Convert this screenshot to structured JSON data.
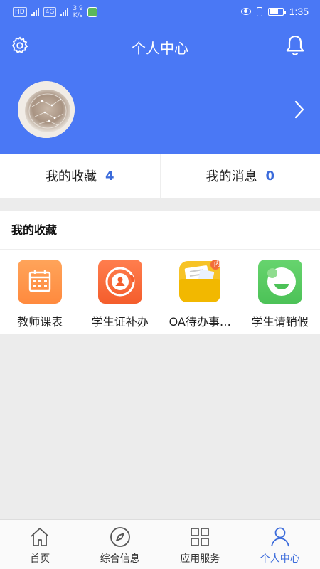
{
  "status_bar": {
    "network_speed": "3.9",
    "network_speed_unit": "K/s",
    "time": "1:35",
    "signal_chip_1": "HD",
    "signal_chip_2": "4G"
  },
  "header": {
    "title": "个人中心",
    "settings_icon": "gear-icon",
    "notification_icon": "bell-icon",
    "background_color": "#4a78f5"
  },
  "stats": [
    {
      "label": "我的收藏",
      "count": "4"
    },
    {
      "label": "我的消息",
      "count": "0"
    }
  ],
  "favorites": {
    "title": "我的收藏",
    "items": [
      {
        "label": "教师课表",
        "icon": "calendar-icon",
        "color": "#ff9a4c"
      },
      {
        "label": "学生证补办",
        "icon": "student-card-icon",
        "color": "#f76a38"
      },
      {
        "label": "OA待办事…",
        "icon": "oa-folder-icon",
        "badge": "内",
        "color": "#f7c326"
      },
      {
        "label": "学生请销假",
        "icon": "leave-icon",
        "color": "#56c85f"
      }
    ]
  },
  "bottom_nav": [
    {
      "label": "首页",
      "icon": "home-icon",
      "active": false
    },
    {
      "label": "综合信息",
      "icon": "compass-icon",
      "active": false
    },
    {
      "label": "应用服务",
      "icon": "grid-icon",
      "active": false
    },
    {
      "label": "个人中心",
      "icon": "user-icon",
      "active": true
    }
  ],
  "colors": {
    "primary": "#4a78f5",
    "accent_count": "#3b6bdb",
    "page_background": "#ececec"
  }
}
